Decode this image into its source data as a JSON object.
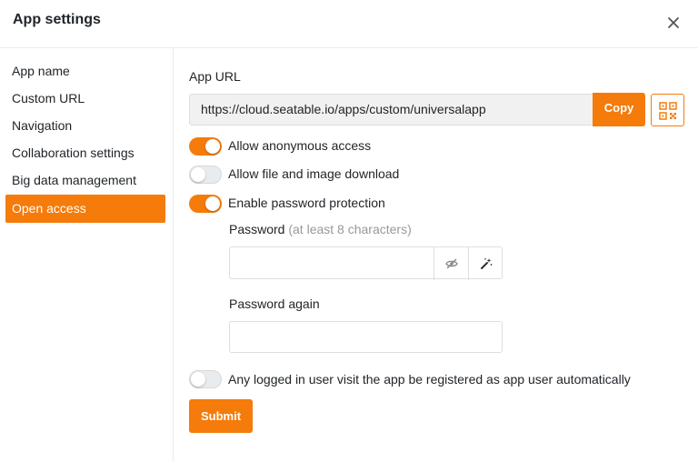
{
  "header": {
    "title": "App settings"
  },
  "sidebar": {
    "items": [
      {
        "label": "App name",
        "active": false
      },
      {
        "label": "Custom URL",
        "active": false
      },
      {
        "label": "Navigation",
        "active": false
      },
      {
        "label": "Collaboration settings",
        "active": false
      },
      {
        "label": "Big data management",
        "active": false
      },
      {
        "label": "Open access",
        "active": true
      }
    ]
  },
  "main": {
    "app_url_label": "App URL",
    "app_url_value": "https://cloud.seatable.io/apps/custom/universalapp",
    "copy_label": "Copy",
    "toggles": [
      {
        "label": "Allow anonymous access",
        "on": true
      },
      {
        "label": "Allow file and image download",
        "on": false
      },
      {
        "label": "Enable password protection",
        "on": true
      }
    ],
    "password_label": "Password",
    "password_hint": "(at least 8 characters)",
    "password_value": "",
    "password_again_label": "Password again",
    "password_again_value": "",
    "auto_register_toggle": {
      "label": "Any logged in user visit the app be registered as app user automatically",
      "on": false
    },
    "submit_label": "Submit"
  },
  "colors": {
    "accent": "#f57b0b"
  },
  "icons": [
    "close-icon",
    "qr-code-icon",
    "eye-off-icon",
    "magic-wand-icon"
  ]
}
